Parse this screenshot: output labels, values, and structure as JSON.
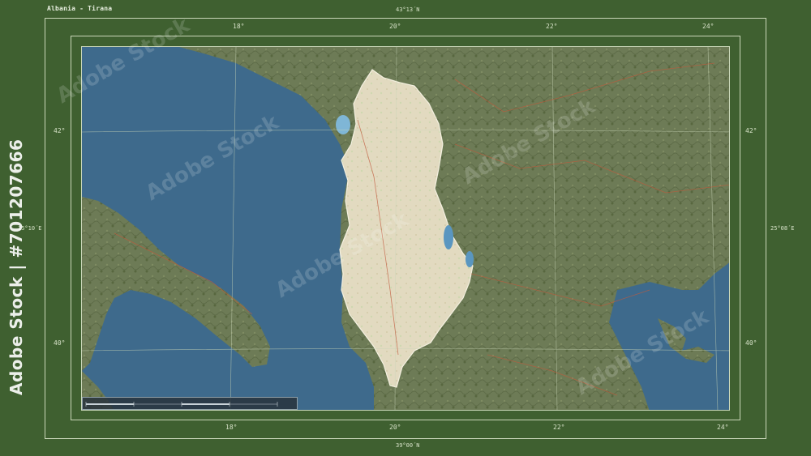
{
  "title": "Albania - Tirana",
  "frame_labels": {
    "top_lat": "43°13´N",
    "bottom_lat": "39°00´N",
    "left_lon": "15°10´E",
    "right_lon": "25°08´E"
  },
  "ticks": {
    "top": [
      "18°",
      "20°",
      "22°",
      "24°"
    ],
    "bottom": [
      "18°",
      "20°",
      "22°",
      "24°"
    ],
    "left": [
      "42°",
      "40°"
    ],
    "right": [
      "42°",
      "40°"
    ]
  },
  "watermark": {
    "vertical": "Adobe Stock | #701207666",
    "text": "Adobe Stock"
  },
  "colors": {
    "frame": "#3f6030",
    "sea": "#3e6a8c",
    "land": "#6b7a55",
    "country": "#e4dcc4"
  }
}
